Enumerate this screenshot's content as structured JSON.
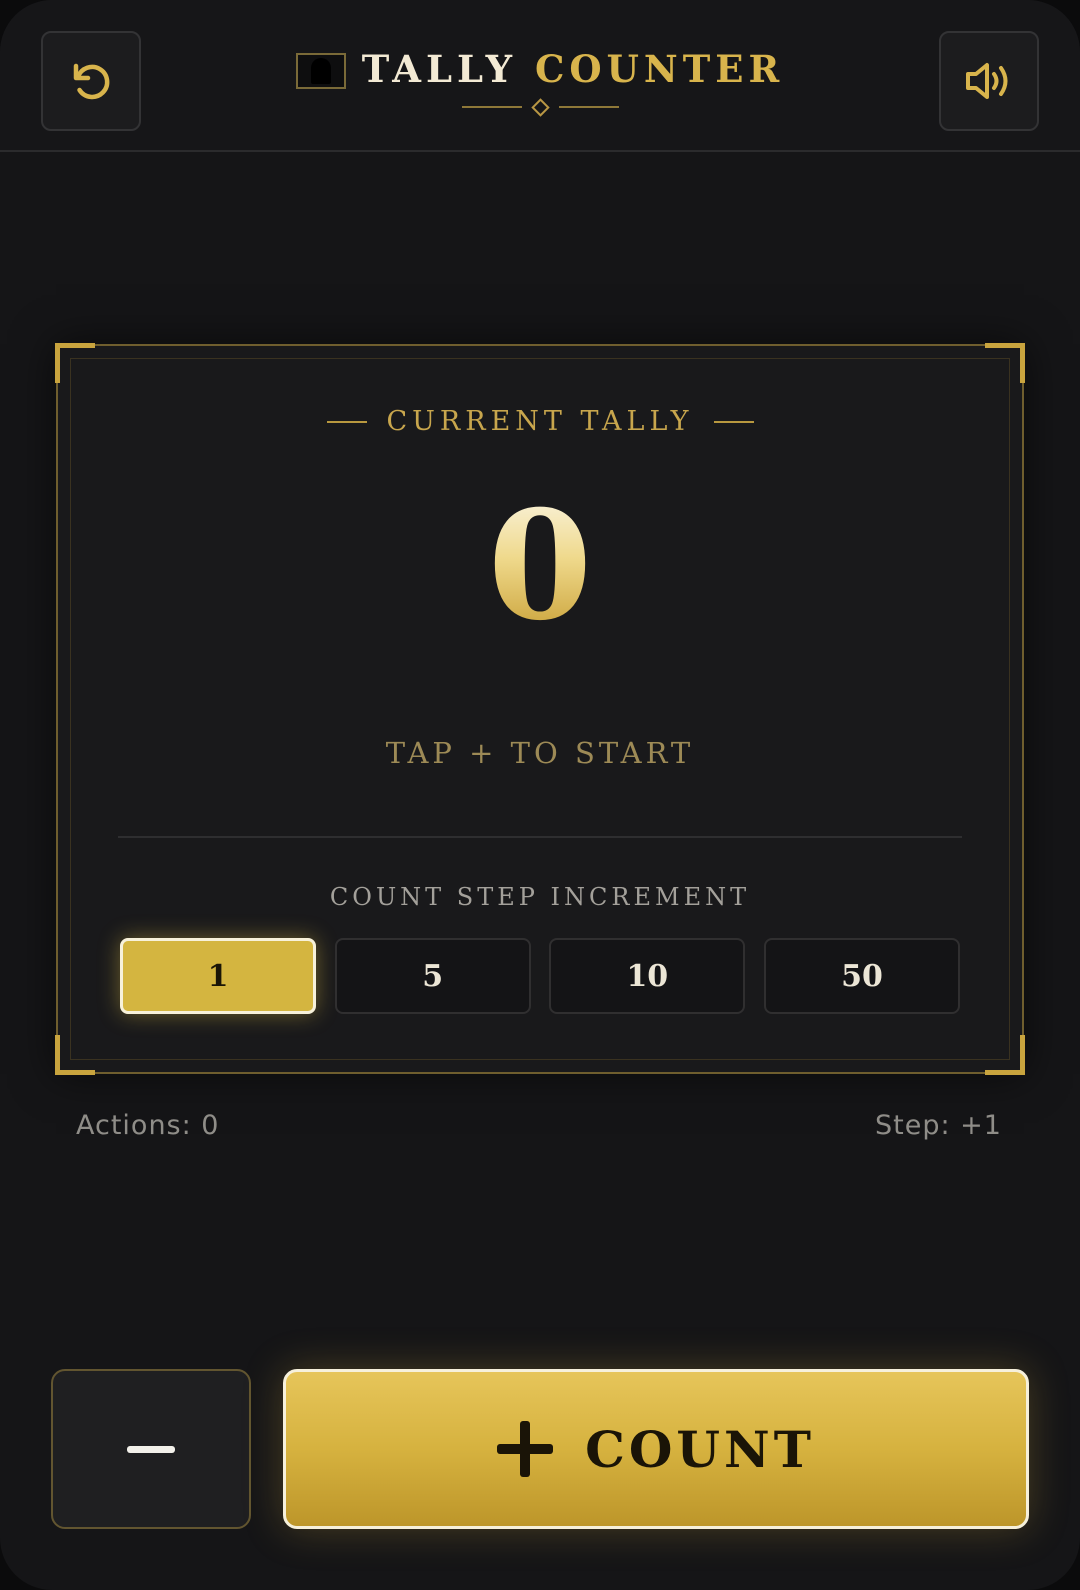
{
  "header": {
    "title_part1": "TALLY",
    "title_part2": "COUNTER",
    "reset_icon": "reset-icon",
    "sound_icon": "speaker-icon",
    "emblem_icon": "emblem-icon"
  },
  "counter": {
    "label": "CURRENT TALLY",
    "value": "0",
    "hint": "TAP + TO START"
  },
  "step": {
    "label": "COUNT STEP INCREMENT",
    "options": [
      "1",
      "5",
      "10",
      "50"
    ],
    "selected": "1"
  },
  "stats": {
    "actions": "Actions: 0",
    "step": "Step: +1"
  },
  "controls": {
    "count_label": "COUNT",
    "minus_icon": "minus-icon",
    "plus_icon": "plus-icon"
  },
  "colors": {
    "accent": "#d4b540",
    "background": "#151517",
    "text_muted": "#8f8d88"
  }
}
